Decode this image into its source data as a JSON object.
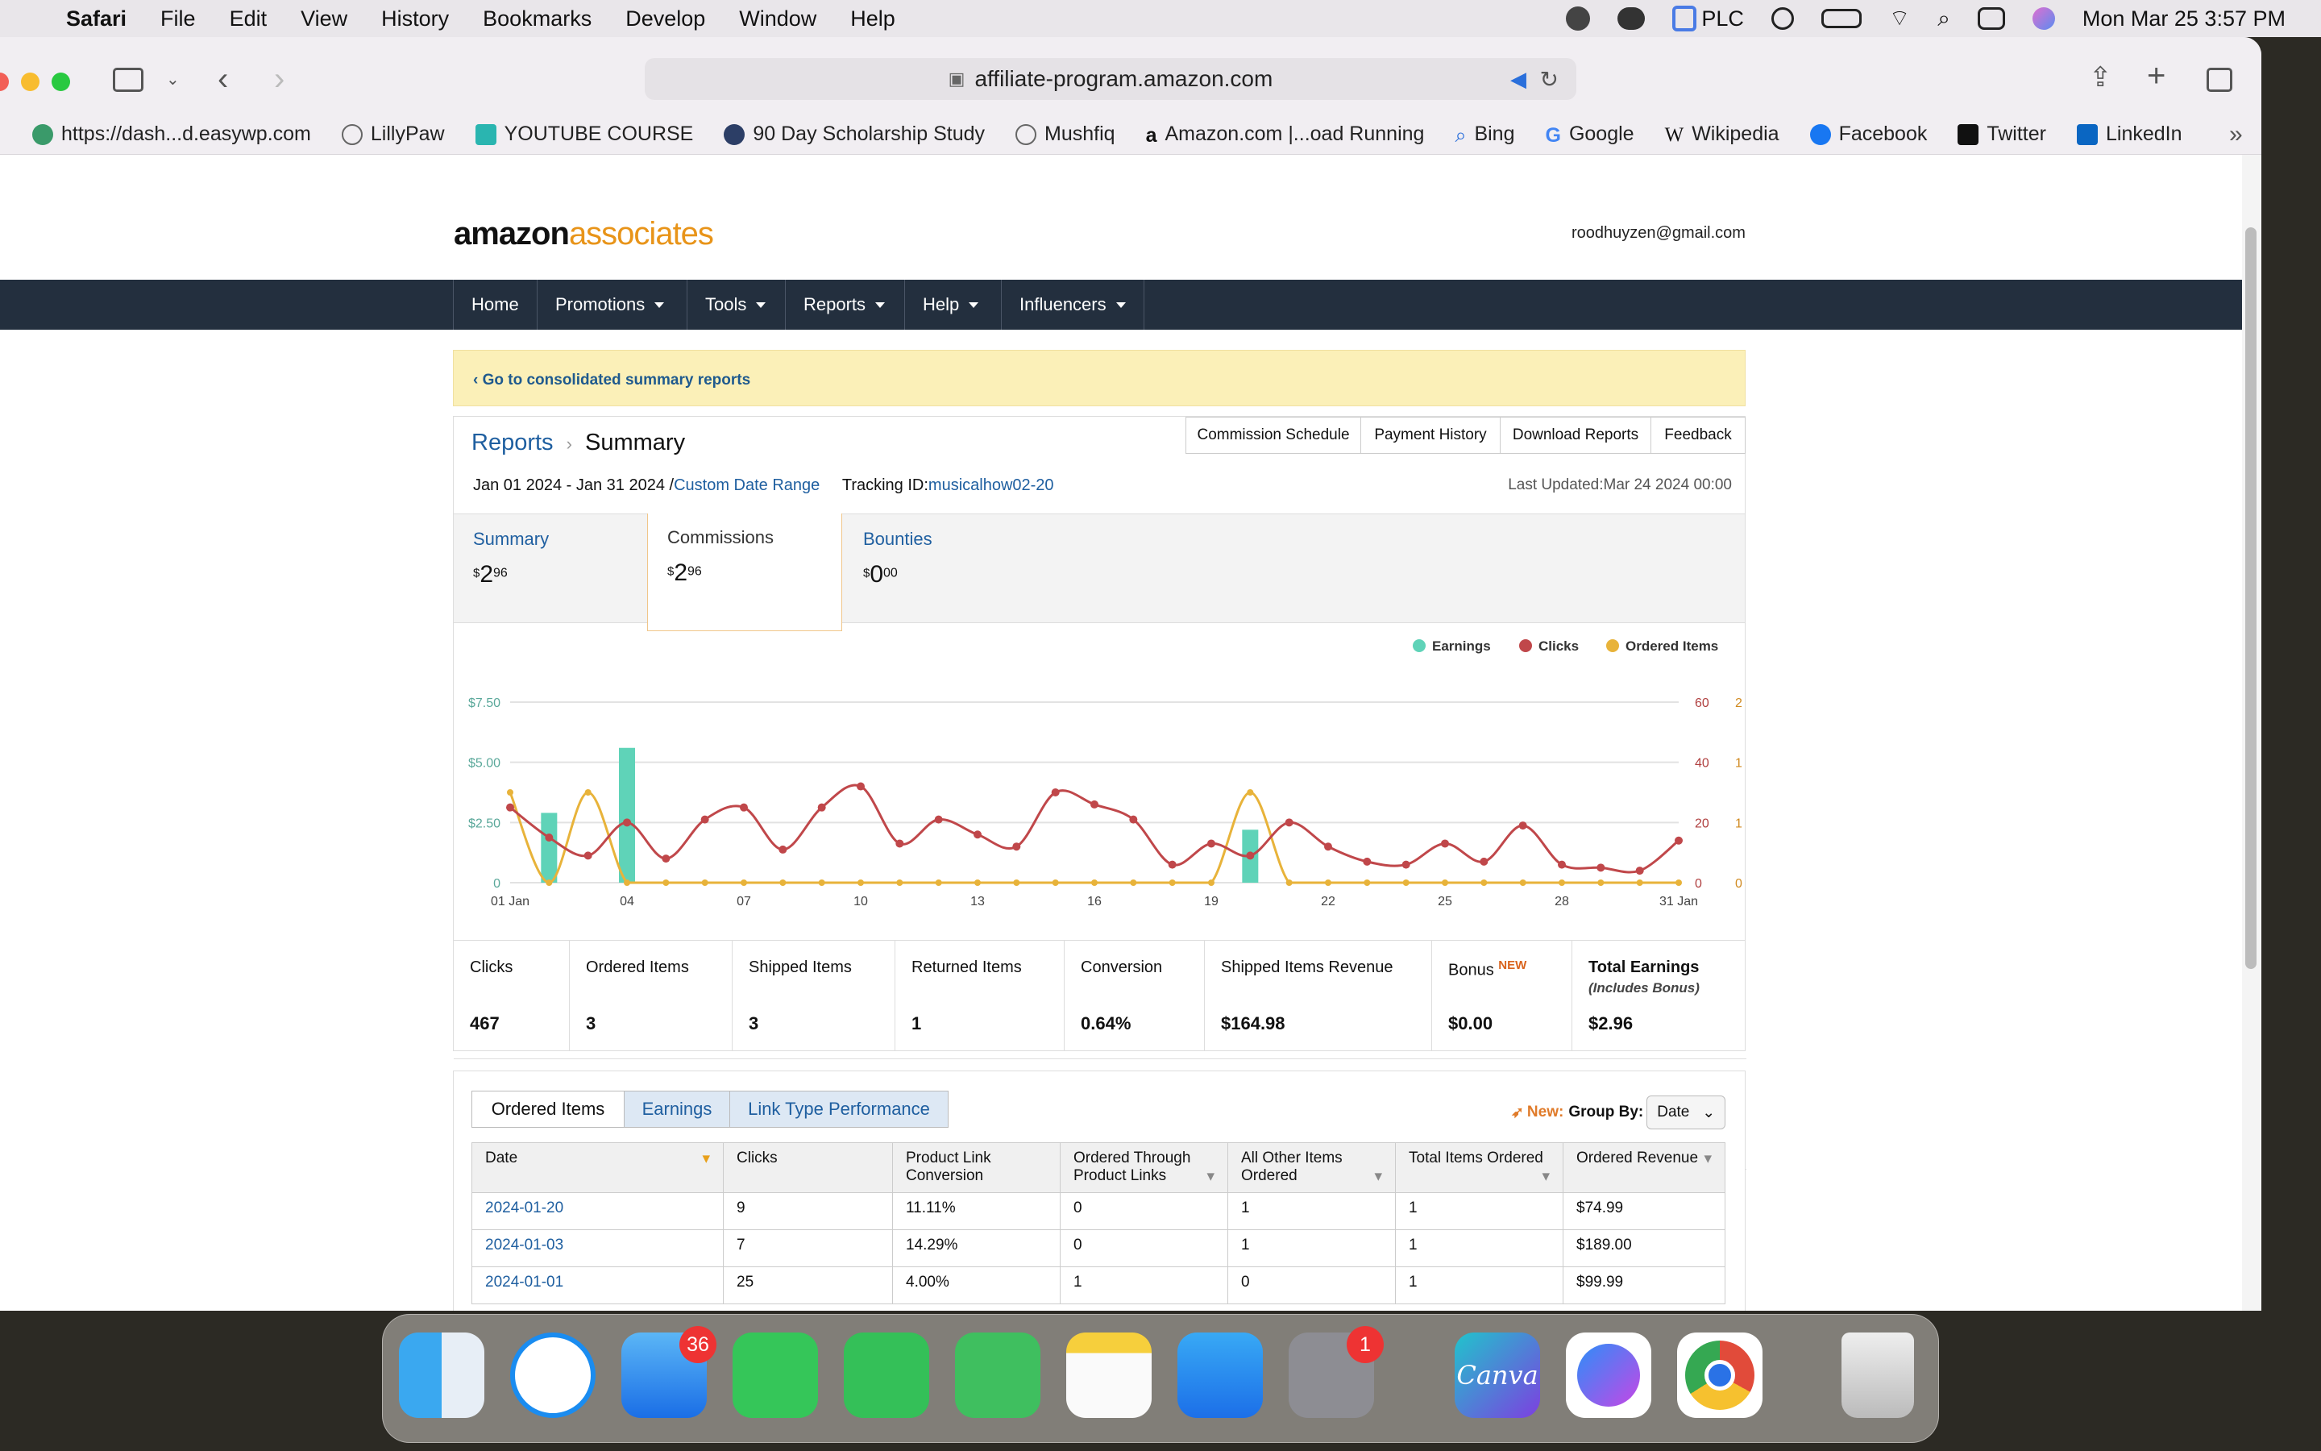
{
  "menubar": {
    "app": "Safari",
    "items": [
      "File",
      "Edit",
      "View",
      "History",
      "Bookmarks",
      "Develop",
      "Window",
      "Help"
    ],
    "plc": "PLC",
    "datetime": "Mon Mar 25  3:57 PM"
  },
  "browser": {
    "url": "affiliate-program.amazon.com",
    "bookmarks": [
      "https://dash...d.easywp.com",
      "LillyPaw",
      "YOUTUBE COURSE",
      "90 Day Scholarship Study",
      "Mushfiq",
      "Amazon.com |...oad Running",
      "Bing",
      "Google",
      "Wikipedia",
      "Facebook",
      "Twitter",
      "LinkedIn"
    ]
  },
  "header": {
    "logo_a": "amazon",
    "logo_b": "associates",
    "email": "roodhuyzen@gmail.com"
  },
  "nav": [
    "Home",
    "Promotions",
    "Tools",
    "Reports",
    "Help",
    "Influencers"
  ],
  "banner": "‹ Go to consolidated summary reports",
  "report": {
    "crumb": "Reports",
    "title": "Summary",
    "buttons": [
      "Commission Schedule",
      "Payment History",
      "Download Reports",
      "Feedback"
    ],
    "range": "Jan 01 2024 - Jan 31 2024 /",
    "custom": "Custom Date Range",
    "tracking_label": "Tracking ID:",
    "tracking_id": "musicalhow02-20",
    "updated": "Last Updated:Mar 24 2024 00:00"
  },
  "tabs": [
    {
      "label": "Summary",
      "dollar": "$",
      "int": "2",
      "dec": "96"
    },
    {
      "label": "Commissions",
      "dollar": "$",
      "int": "2",
      "dec": "96"
    },
    {
      "label": "Bounties",
      "dollar": "$",
      "int": "0",
      "dec": "00"
    }
  ],
  "colors": {
    "earnings": "#5fd3b8",
    "clicks": "#c0474a",
    "ordered": "#e8b33a"
  },
  "chart_data": {
    "type": "bar+line",
    "legend": [
      "Earnings",
      "Clicks",
      "Ordered Items"
    ],
    "x": [
      "01",
      "02",
      "03",
      "04",
      "05",
      "06",
      "07",
      "08",
      "09",
      "10",
      "11",
      "12",
      "13",
      "14",
      "15",
      "16",
      "17",
      "18",
      "19",
      "20",
      "21",
      "22",
      "23",
      "24",
      "25",
      "26",
      "27",
      "28",
      "29",
      "30",
      "31"
    ],
    "x_tick_labels": [
      "01 Jan",
      "04",
      "07",
      "10",
      "13",
      "16",
      "19",
      "22",
      "25",
      "28",
      "31 Jan"
    ],
    "earnings": [
      0,
      2.9,
      0,
      5.6,
      0,
      0,
      0,
      0,
      0,
      0,
      0,
      0,
      0,
      0,
      0,
      0,
      0,
      0,
      0,
      2.2,
      0,
      0,
      0,
      0,
      0,
      0,
      0,
      0,
      0,
      0,
      0
    ],
    "clicks": [
      25,
      15,
      9,
      20,
      8,
      21,
      25,
      11,
      25,
      32,
      13,
      21,
      16,
      12,
      30,
      26,
      21,
      6,
      13,
      9,
      20,
      12,
      7,
      6,
      13,
      7,
      19,
      6,
      5,
      4,
      14
    ],
    "ordered_items": [
      1,
      0,
      1,
      0,
      0,
      0,
      0,
      0,
      0,
      0,
      0,
      0,
      0,
      0,
      0,
      0,
      0,
      0,
      0,
      1,
      0,
      0,
      0,
      0,
      0,
      0,
      0,
      0,
      0,
      0,
      0
    ],
    "y_earnings_ticks": [
      "0",
      "$2.50",
      "$5.00",
      "$7.50"
    ],
    "y_earnings_range": [
      0,
      7.5
    ],
    "y_clicks_ticks": [
      "0",
      "20",
      "40",
      "60"
    ],
    "y_clicks_range": [
      0,
      60
    ],
    "y_items_ticks": [
      "0",
      "1",
      "1",
      "2"
    ],
    "y_items_range": [
      0,
      2
    ]
  },
  "stats": [
    {
      "label": "Clicks",
      "value": "467"
    },
    {
      "label": "Ordered Items",
      "value": "3"
    },
    {
      "label": "Shipped Items",
      "value": "3"
    },
    {
      "label": "Returned Items",
      "value": "1"
    },
    {
      "label": "Conversion",
      "value": "0.64%"
    },
    {
      "label": "Shipped Items Revenue",
      "value": "$164.98"
    },
    {
      "label": "Bonus",
      "badge": "NEW",
      "value": "$0.00"
    },
    {
      "label": "Total Earnings",
      "sub": "(Includes Bonus)",
      "value": "$2.96"
    }
  ],
  "table_tabs": [
    "Ordered Items",
    "Earnings",
    "Link Type Performance"
  ],
  "groupby": {
    "new": "New:",
    "label": "Group By:",
    "value": "Date"
  },
  "table": {
    "headers": [
      "Date",
      "Clicks",
      "Product Link Conversion",
      "Ordered Through Product Links",
      "All Other Items Ordered",
      "Total Items Ordered",
      "Ordered Revenue"
    ],
    "rows": [
      [
        "2024-01-20",
        "9",
        "11.11%",
        "0",
        "1",
        "1",
        "$74.99"
      ],
      [
        "2024-01-03",
        "7",
        "14.29%",
        "0",
        "1",
        "1",
        "$189.00"
      ],
      [
        "2024-01-01",
        "25",
        "4.00%",
        "1",
        "0",
        "1",
        "$99.99"
      ]
    ]
  },
  "dock": {
    "mail_badge": "36",
    "settings_badge": "1",
    "canva": "Canva"
  }
}
